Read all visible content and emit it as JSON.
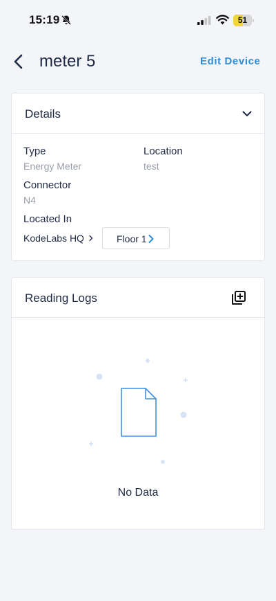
{
  "status_bar": {
    "time": "15:19",
    "battery_level": "51",
    "battery_fraction": 0.51
  },
  "header": {
    "title": "meter 5",
    "edit_label": "Edit Device"
  },
  "details": {
    "title": "Details",
    "type_label": "Type",
    "type_value": "Energy Meter",
    "location_label": "Location",
    "location_value": "test",
    "connector_label": "Connector",
    "connector_value": "N4",
    "located_in_label": "Located In",
    "building": "KodeLabs HQ",
    "floor": "Floor 1"
  },
  "reading_logs": {
    "title": "Reading Logs",
    "empty_text": "No Data"
  },
  "colors": {
    "accent": "#2d8ed9",
    "text": "#1f2a44",
    "muted": "#9aa0ab",
    "battery": "#f2d633"
  },
  "icons": [
    "bell-slash-icon",
    "signal-icon",
    "wifi-icon",
    "battery-icon",
    "back-chevron-icon",
    "chevron-down-icon",
    "add-copy-icon",
    "chevron-right-icon",
    "empty-document-icon"
  ]
}
